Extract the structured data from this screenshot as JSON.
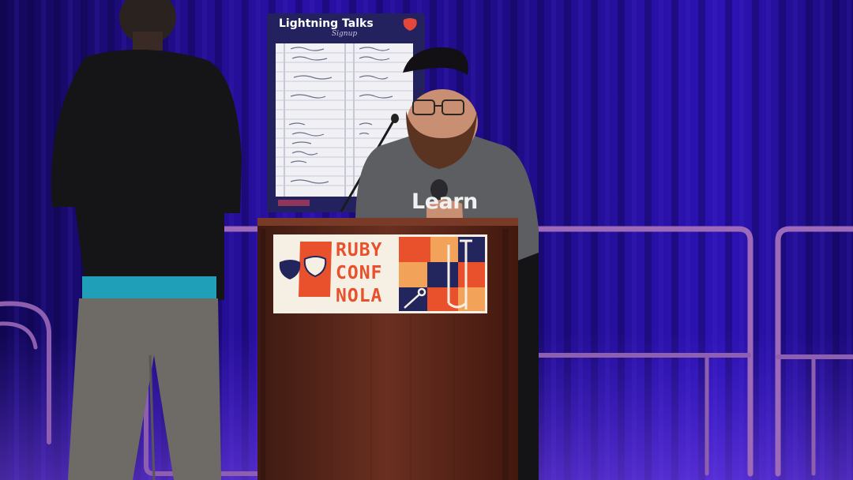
{
  "signup_board": {
    "title": "Lightning Talks",
    "subtitle": "Signup"
  },
  "speaker": {
    "shirt_text": "Learn"
  },
  "podium_sign": {
    "line1": "RUBY",
    "line2": "CONF",
    "line3": "NOLA",
    "colors": {
      "orange": "#e8512b",
      "navy": "#22265c",
      "peach": "#f3a25a",
      "cream": "#f6efe4"
    }
  },
  "colors": {
    "curtain": "#1a0b6e",
    "stage_light": "#5a2be0",
    "railing": "#b07ac8",
    "podium_wood": "#5e2a1d"
  }
}
